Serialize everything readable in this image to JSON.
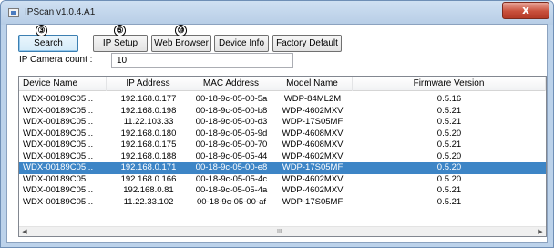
{
  "window": {
    "title": "IPScan v1.0.4.A1",
    "close_glyph": "x"
  },
  "toolbar": {
    "buttons": [
      {
        "label": "Search",
        "callout": "③"
      },
      {
        "label": "IP  Setup",
        "callout": "⑤"
      },
      {
        "label": "Web Browser",
        "callout": "⑩"
      },
      {
        "label": "Device Info"
      },
      {
        "label": "Factory Default"
      }
    ]
  },
  "camera_count": {
    "label": "IP Camera count :",
    "value": "10"
  },
  "table": {
    "columns": [
      "Device Name",
      "IP Address",
      "MAC Address",
      "Model Name",
      "Firmware Version"
    ],
    "rows": [
      [
        "WDX-00189C05...",
        "192.168.0.177",
        "00-18-9c-05-00-5a",
        "WDP-84ML2M",
        "0.5.16"
      ],
      [
        "WDX-00189C05...",
        "192.168.0.198",
        "00-18-9c-05-00-b8",
        "WDP-4602MXV",
        "0.5.21"
      ],
      [
        "WDX-00189C05...",
        "11.22.103.33",
        "00-18-9c-05-00-d3",
        "WDP-17S05MF",
        "0.5.21"
      ],
      [
        "WDX-00189C05...",
        "192.168.0.180",
        "00-18-9c-05-05-9d",
        "WDP-4608MXV",
        "0.5.20"
      ],
      [
        "WDX-00189C05...",
        "192.168.0.175",
        "00-18-9c-05-00-70",
        "WDP-4608MXV",
        "0.5.21"
      ],
      [
        "WDX-00189C05...",
        "192.168.0.188",
        "00-18-9c-05-05-44",
        "WDP-4602MXV",
        "0.5.20"
      ],
      [
        "WDX-00189C05...",
        "192.168.0.171",
        "00-18-9c-05-00-e8",
        "WDP-17S05MF",
        "0.5.20"
      ],
      [
        "WDX-00189C05...",
        "192.168.0.166",
        "00-18-9c-05-05-4c",
        "WDP-4602MXV",
        "0.5.20"
      ],
      [
        "WDX-00189C05...",
        "192.168.0.81",
        "00-18-9c-05-05-4a",
        "WDP-4602MXV",
        "0.5.21"
      ],
      [
        "WDX-00189C05...",
        "11.22.33.102",
        "00-18-9c-05-00-af",
        "WDP-17S05MF",
        "0.5.21"
      ]
    ],
    "selected_row": 6
  },
  "scrollbar": {
    "left_arrow": "◀",
    "right_arrow": "▶",
    "grip": "III"
  },
  "colors": {
    "selection": "#3d85c6",
    "frame": "#bcd2ea",
    "close": "#c9503c"
  }
}
